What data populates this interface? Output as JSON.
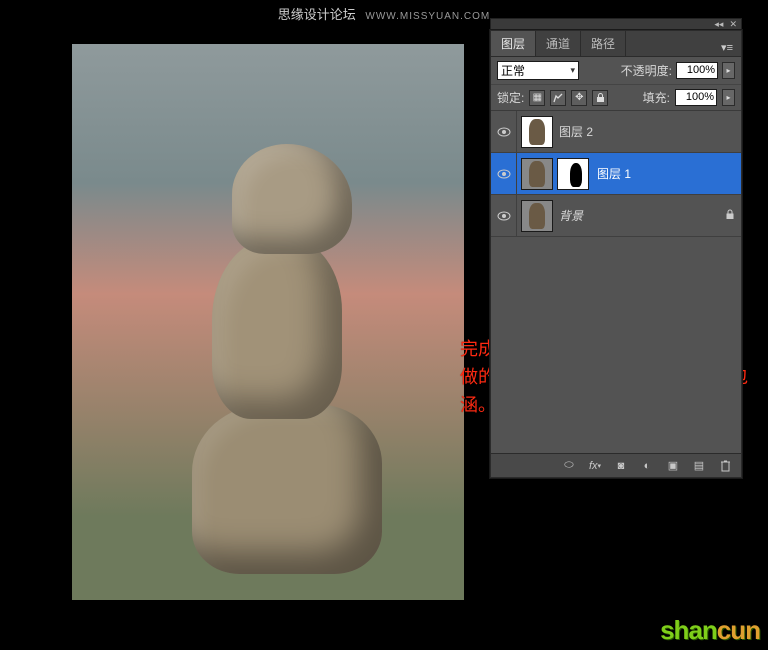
{
  "header": {
    "title": "思缘设计论坛",
    "site": "WWW.MISSYUAN.COM"
  },
  "annotation": "完成收工，喜欢的童鞋可以做一下，做的不够精细，不到处请大家多多包涵。",
  "panel": {
    "tabs": [
      "图层",
      "通道",
      "路径"
    ],
    "active_tab": 0,
    "blend_mode": "正常",
    "opacity_label": "不透明度:",
    "opacity_value": "100%",
    "lock_label": "锁定:",
    "fill_label": "填充:",
    "fill_value": "100%",
    "layers": [
      {
        "name": "图层 2",
        "visible": true,
        "selected": false,
        "has_mask": false,
        "locked": false
      },
      {
        "name": "图层 1",
        "visible": true,
        "selected": true,
        "has_mask": true,
        "locked": false
      },
      {
        "name": "背景",
        "visible": true,
        "selected": false,
        "has_mask": false,
        "locked": true,
        "italic": true
      }
    ],
    "footer_icons": [
      "link",
      "fx",
      "mask",
      "adjust",
      "group",
      "new",
      "trash"
    ]
  },
  "logo": {
    "part1": "shan",
    "part2": "cun"
  }
}
